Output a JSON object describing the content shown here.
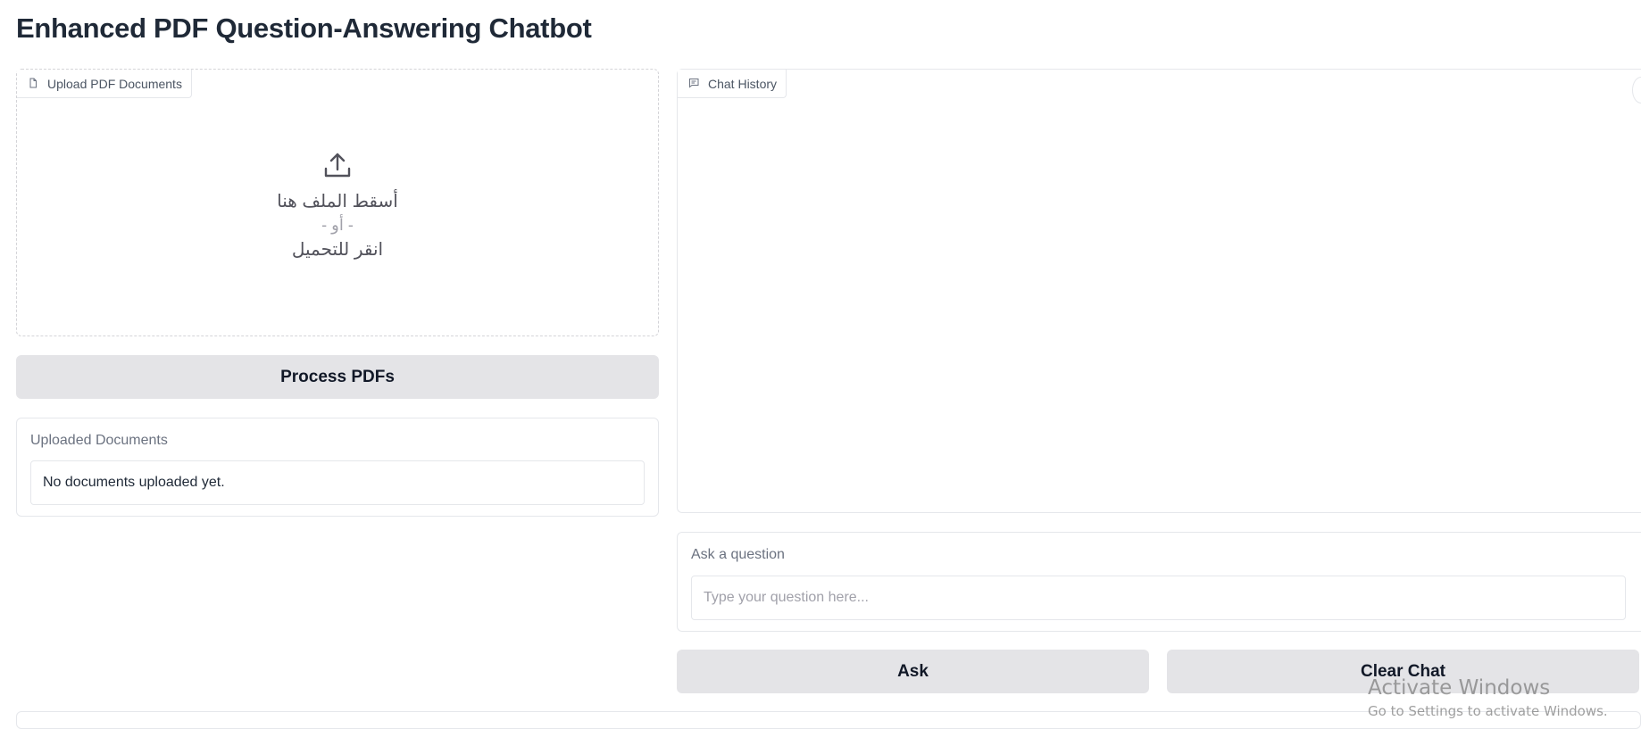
{
  "page": {
    "title": "Enhanced PDF Question-Answering Chatbot"
  },
  "upload": {
    "label": "Upload PDF Documents",
    "icon": "file-icon",
    "upload_icon": "upload-icon",
    "drop_text": "أسقط الملف هنا",
    "or_text": "- أو -",
    "click_text": "انقر للتحميل"
  },
  "process_button": {
    "label": "Process PDFs"
  },
  "documents": {
    "label": "Uploaded Documents",
    "value": "No documents uploaded yet."
  },
  "chat": {
    "label": "Chat History",
    "icon": "chat-icon"
  },
  "question": {
    "label": "Ask a question",
    "placeholder": "Type your question here...",
    "value": ""
  },
  "ask_button": {
    "label": "Ask"
  },
  "clear_button": {
    "label": "Clear Chat"
  },
  "watermark": {
    "title": "Activate Windows",
    "subtitle": "Go to Settings to activate Windows."
  }
}
